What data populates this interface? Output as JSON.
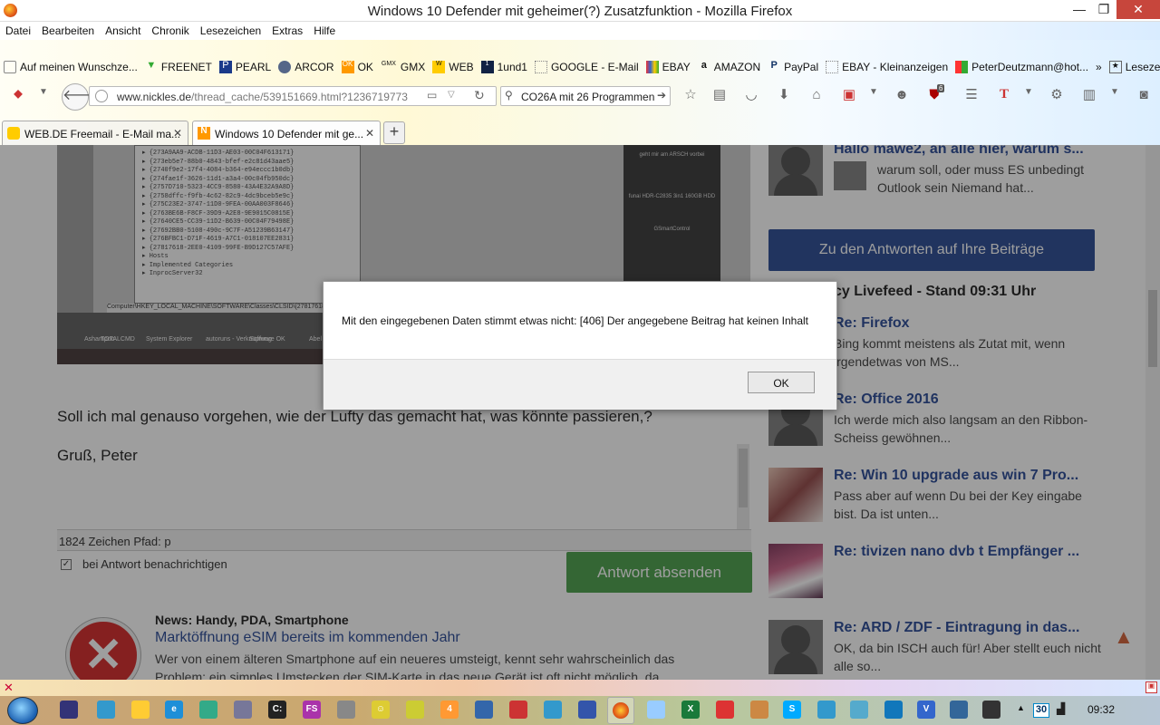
{
  "window": {
    "title": "Windows 10 Defender mit geheimer(?) Zusatzfunktion - Mozilla Firefox",
    "min": "—",
    "max": "❐",
    "close": "✕"
  },
  "menu": [
    "Datei",
    "Bearbeiten",
    "Ansicht",
    "Chronik",
    "Lesezeichen",
    "Extras",
    "Hilfe"
  ],
  "bookmarks": [
    {
      "label": "Auf meinen Wunschze...",
      "icon": "page-icon"
    },
    {
      "label": "FREENET",
      "icon": "freenet-icon"
    },
    {
      "label": "PEARL",
      "icon": "pearl-icon"
    },
    {
      "label": "ARCOR",
      "icon": "arcor-icon"
    },
    {
      "label": "OK",
      "icon": "ok-icon"
    },
    {
      "label": "GMX",
      "icon": "gmx-icon"
    },
    {
      "label": "WEB",
      "icon": "web-icon"
    },
    {
      "label": "1und1",
      "icon": "1und1-icon"
    },
    {
      "label": "GOOGLE - E-Mail",
      "icon": "page-icon"
    },
    {
      "label": "EBAY",
      "icon": "ebay-icon"
    },
    {
      "label": "AMAZON",
      "icon": "amazon-icon"
    },
    {
      "label": "PayPal",
      "icon": "paypal-icon"
    },
    {
      "label": "EBAY - Kleinanzeigen",
      "icon": "page-icon"
    },
    {
      "label": "PeterDeutzmann@hot...",
      "icon": "windows-icon"
    }
  ],
  "bookmarks_more": "»",
  "bookmarks_menu": "Lesezeichen",
  "nav": {
    "url_host": "www.nickles.de",
    "url_path": "/thread_cache/539151669.html?1236719773",
    "search_value": "CO26A mit 26 Programmen",
    "addon_badge": "6"
  },
  "tabs": [
    {
      "label": "WEB.DE Freemail - E-Mail ma...",
      "favicon": "webde-icon"
    },
    {
      "label": "Windows 10 Defender mit ge...",
      "favicon": "nickles-icon"
    }
  ],
  "new_tab": "+",
  "screenshot_embed": {
    "tree_lines": [
      "{273A9AA9-ACDB-11D3-AE03-00C04F613171}",
      "{273eb5e7-88b0-4843-bfef-e2c81d43aae5}",
      "{2740f9e2-17f4-4084-b364-e94eccc1b0db}",
      "{274fae1f-3626-11d1-a3a4-00c04fb950dc}",
      "{2757D710-5323-4CC9-8580-43A4E32A9A8D}",
      "{2758dffc-f9fb-4c62-82c9-4dc9bceb5e9c}",
      "{275C23E2-3747-11D0-9FEA-00AA003F8646}",
      "{2763BE6B-F8CF-39D9-A2E8-9E9015C0815E}",
      "{27640CE5-CC39-11D2-B639-00C04F79498E}",
      "{27692BB0-5108-490c-9C7F-A51239B63147}",
      "{276BFBC1-D71F-4619-A7C1-018107EE2831}",
      "{27817618-2EE0-4109-99FE-B9D127C57AFE}",
      "Hosts",
      "Implemented Categories",
      "InprocServer32"
    ],
    "path_bar": "Computer\\HKEY_LOCAL_MACHINE\\SOFTWARE\\Classes\\CLSID\\{27817618-2EE",
    "side_labels": [
      "geht mir am ARSCH vorbei",
      "funai HDR-C2835 3in1 160GB HDD",
      "GSmartControl"
    ],
    "taskbar_labels": [
      "Ashampoo",
      "TOTALCMD",
      "System Explorer",
      "autoruns - Verknüpfung",
      "Software OK",
      "Abel"
    ]
  },
  "post": {
    "text": "Soll ich mal genauso vorgehen, wie der Lufty das gemacht hat, was könnte passieren,?",
    "greeting": "Gruß, Peter",
    "counter": "1824 Zeichen Pfad: p",
    "notify_label": "bei Antwort benachrichtigen",
    "notify_checked": "✓",
    "send_label": "Antwort absenden"
  },
  "news": {
    "category": "News: Handy, PDA, Smartphone",
    "title": "Marktöffnung eSIM bereits im kommenden Jahr",
    "body": "Wer von einem älteren Smartphone auf ein neueres umsteigt, kennt sehr wahrscheinlich das Problem: ein simples Umstecken der SIM-Karte in das neue Gerät ist oft nicht möglich, da"
  },
  "sidebar": {
    "first_item": {
      "title": "Hallo mawe2, an alle hier, warum s...",
      "body": "warum soll, oder muss ES unbedingt Outlook sein Niemand hat..."
    },
    "answers_button": "Zu den Antworten auf Ihre Beiträge",
    "livefeed_title": "cy Livefeed - Stand 09:31 Uhr",
    "feed": [
      {
        "title": "Re: Firefox",
        "body": "Bing kommt meistens als Zutat mit, wenn irgendetwas von MS..."
      },
      {
        "title": "Re: Office 2016",
        "body": "Ich werde mich also langsam an den Ribbon-Scheiss gewöhnen..."
      },
      {
        "title": "Re: Win 10 upgrade aus win 7 Pro...",
        "body": "Pass aber auf wenn Du bei der Key eingabe bist. Da ist unten..."
      },
      {
        "title": "Re: tivizen nano dvb t Empfänger ...",
        "body": ""
      },
      {
        "title": "Re: ARD / ZDF - Eintragung in das...",
        "body": "OK, da bin ISCH auch für! Aber stellt euch nicht alle so..."
      }
    ]
  },
  "dialog": {
    "message": "Mit den eingegebenen Daten stimmt etwas nicht: [406] Der angegebene Beitrag hat keinen Inhalt",
    "ok": "OK"
  },
  "taskbar": {
    "clock": "09:32",
    "day": "30"
  }
}
